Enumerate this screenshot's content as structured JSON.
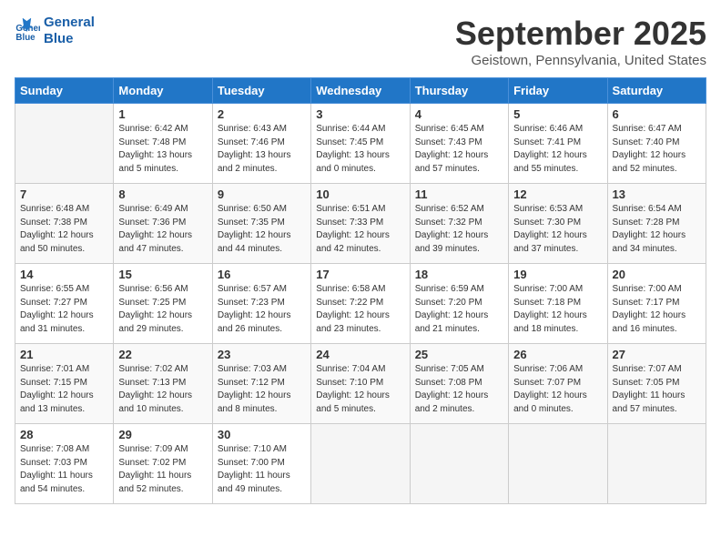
{
  "header": {
    "logo_line1": "General",
    "logo_line2": "Blue",
    "month_title": "September 2025",
    "location": "Geistown, Pennsylvania, United States"
  },
  "days_of_week": [
    "Sunday",
    "Monday",
    "Tuesday",
    "Wednesday",
    "Thursday",
    "Friday",
    "Saturday"
  ],
  "weeks": [
    [
      {
        "day": "",
        "info": ""
      },
      {
        "day": "1",
        "info": "Sunrise: 6:42 AM\nSunset: 7:48 PM\nDaylight: 13 hours\nand 5 minutes."
      },
      {
        "day": "2",
        "info": "Sunrise: 6:43 AM\nSunset: 7:46 PM\nDaylight: 13 hours\nand 2 minutes."
      },
      {
        "day": "3",
        "info": "Sunrise: 6:44 AM\nSunset: 7:45 PM\nDaylight: 13 hours\nand 0 minutes."
      },
      {
        "day": "4",
        "info": "Sunrise: 6:45 AM\nSunset: 7:43 PM\nDaylight: 12 hours\nand 57 minutes."
      },
      {
        "day": "5",
        "info": "Sunrise: 6:46 AM\nSunset: 7:41 PM\nDaylight: 12 hours\nand 55 minutes."
      },
      {
        "day": "6",
        "info": "Sunrise: 6:47 AM\nSunset: 7:40 PM\nDaylight: 12 hours\nand 52 minutes."
      }
    ],
    [
      {
        "day": "7",
        "info": "Sunrise: 6:48 AM\nSunset: 7:38 PM\nDaylight: 12 hours\nand 50 minutes."
      },
      {
        "day": "8",
        "info": "Sunrise: 6:49 AM\nSunset: 7:36 PM\nDaylight: 12 hours\nand 47 minutes."
      },
      {
        "day": "9",
        "info": "Sunrise: 6:50 AM\nSunset: 7:35 PM\nDaylight: 12 hours\nand 44 minutes."
      },
      {
        "day": "10",
        "info": "Sunrise: 6:51 AM\nSunset: 7:33 PM\nDaylight: 12 hours\nand 42 minutes."
      },
      {
        "day": "11",
        "info": "Sunrise: 6:52 AM\nSunset: 7:32 PM\nDaylight: 12 hours\nand 39 minutes."
      },
      {
        "day": "12",
        "info": "Sunrise: 6:53 AM\nSunset: 7:30 PM\nDaylight: 12 hours\nand 37 minutes."
      },
      {
        "day": "13",
        "info": "Sunrise: 6:54 AM\nSunset: 7:28 PM\nDaylight: 12 hours\nand 34 minutes."
      }
    ],
    [
      {
        "day": "14",
        "info": "Sunrise: 6:55 AM\nSunset: 7:27 PM\nDaylight: 12 hours\nand 31 minutes."
      },
      {
        "day": "15",
        "info": "Sunrise: 6:56 AM\nSunset: 7:25 PM\nDaylight: 12 hours\nand 29 minutes."
      },
      {
        "day": "16",
        "info": "Sunrise: 6:57 AM\nSunset: 7:23 PM\nDaylight: 12 hours\nand 26 minutes."
      },
      {
        "day": "17",
        "info": "Sunrise: 6:58 AM\nSunset: 7:22 PM\nDaylight: 12 hours\nand 23 minutes."
      },
      {
        "day": "18",
        "info": "Sunrise: 6:59 AM\nSunset: 7:20 PM\nDaylight: 12 hours\nand 21 minutes."
      },
      {
        "day": "19",
        "info": "Sunrise: 7:00 AM\nSunset: 7:18 PM\nDaylight: 12 hours\nand 18 minutes."
      },
      {
        "day": "20",
        "info": "Sunrise: 7:00 AM\nSunset: 7:17 PM\nDaylight: 12 hours\nand 16 minutes."
      }
    ],
    [
      {
        "day": "21",
        "info": "Sunrise: 7:01 AM\nSunset: 7:15 PM\nDaylight: 12 hours\nand 13 minutes."
      },
      {
        "day": "22",
        "info": "Sunrise: 7:02 AM\nSunset: 7:13 PM\nDaylight: 12 hours\nand 10 minutes."
      },
      {
        "day": "23",
        "info": "Sunrise: 7:03 AM\nSunset: 7:12 PM\nDaylight: 12 hours\nand 8 minutes."
      },
      {
        "day": "24",
        "info": "Sunrise: 7:04 AM\nSunset: 7:10 PM\nDaylight: 12 hours\nand 5 minutes."
      },
      {
        "day": "25",
        "info": "Sunrise: 7:05 AM\nSunset: 7:08 PM\nDaylight: 12 hours\nand 2 minutes."
      },
      {
        "day": "26",
        "info": "Sunrise: 7:06 AM\nSunset: 7:07 PM\nDaylight: 12 hours\nand 0 minutes."
      },
      {
        "day": "27",
        "info": "Sunrise: 7:07 AM\nSunset: 7:05 PM\nDaylight: 11 hours\nand 57 minutes."
      }
    ],
    [
      {
        "day": "28",
        "info": "Sunrise: 7:08 AM\nSunset: 7:03 PM\nDaylight: 11 hours\nand 54 minutes."
      },
      {
        "day": "29",
        "info": "Sunrise: 7:09 AM\nSunset: 7:02 PM\nDaylight: 11 hours\nand 52 minutes."
      },
      {
        "day": "30",
        "info": "Sunrise: 7:10 AM\nSunset: 7:00 PM\nDaylight: 11 hours\nand 49 minutes."
      },
      {
        "day": "",
        "info": ""
      },
      {
        "day": "",
        "info": ""
      },
      {
        "day": "",
        "info": ""
      },
      {
        "day": "",
        "info": ""
      }
    ]
  ]
}
